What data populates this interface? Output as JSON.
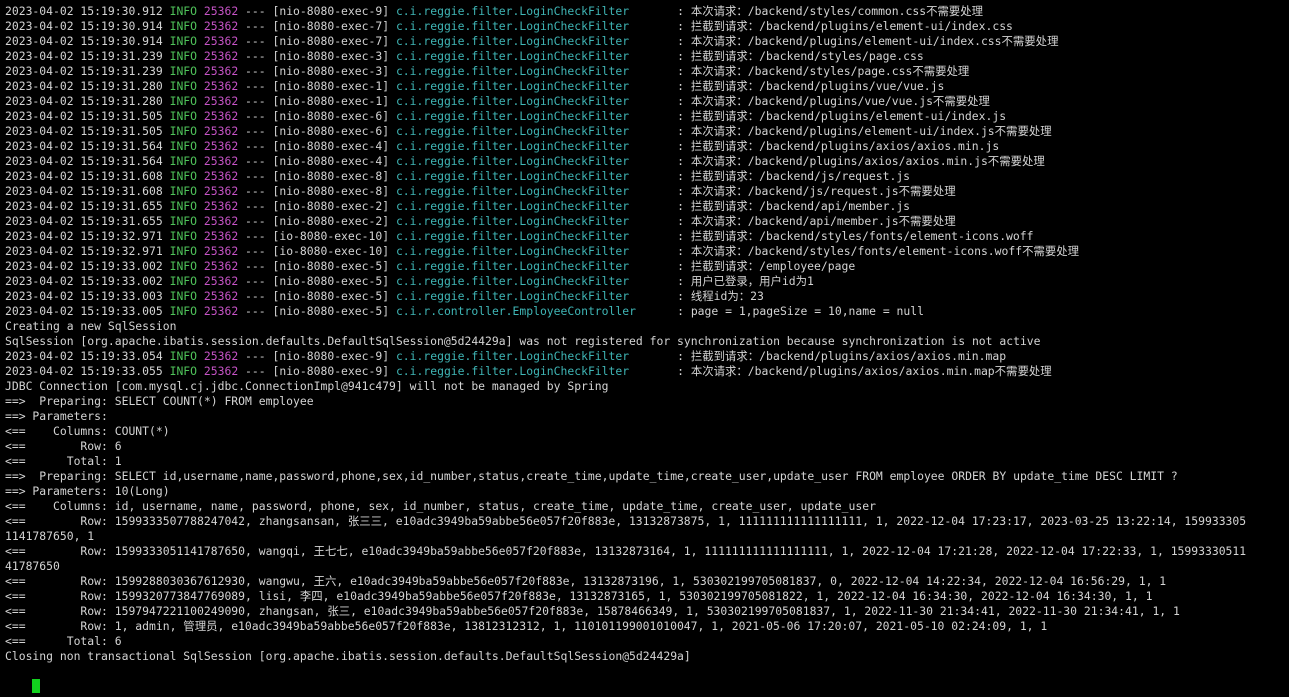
{
  "terminal": {
    "colors": {
      "background": "#000000",
      "text": "#d4d4d4",
      "level": "#4fc35a",
      "pid": "#c653c6",
      "logger": "#3fb6b6",
      "cursor": "#12d11e"
    },
    "lines": [
      {
        "type": "log",
        "ts": "2023-04-02 15:19:30.912",
        "level": "INFO",
        "pid": "25362",
        "sep": "---",
        "thread": "[nio-8080-exec-9]",
        "logger": "c.i.reggie.filter.LoginCheckFilter      ",
        "msg": ": 本次请求：/backend/styles/common.css不需要处理"
      },
      {
        "type": "log",
        "ts": "2023-04-02 15:19:30.914",
        "level": "INFO",
        "pid": "25362",
        "sep": "---",
        "thread": "[nio-8080-exec-7]",
        "logger": "c.i.reggie.filter.LoginCheckFilter      ",
        "msg": ": 拦截到请求：/backend/plugins/element-ui/index.css"
      },
      {
        "type": "log",
        "ts": "2023-04-02 15:19:30.914",
        "level": "INFO",
        "pid": "25362",
        "sep": "---",
        "thread": "[nio-8080-exec-7]",
        "logger": "c.i.reggie.filter.LoginCheckFilter      ",
        "msg": ": 本次请求：/backend/plugins/element-ui/index.css不需要处理"
      },
      {
        "type": "log",
        "ts": "2023-04-02 15:19:31.239",
        "level": "INFO",
        "pid": "25362",
        "sep": "---",
        "thread": "[nio-8080-exec-3]",
        "logger": "c.i.reggie.filter.LoginCheckFilter      ",
        "msg": ": 拦截到请求：/backend/styles/page.css"
      },
      {
        "type": "log",
        "ts": "2023-04-02 15:19:31.239",
        "level": "INFO",
        "pid": "25362",
        "sep": "---",
        "thread": "[nio-8080-exec-3]",
        "logger": "c.i.reggie.filter.LoginCheckFilter      ",
        "msg": ": 本次请求：/backend/styles/page.css不需要处理"
      },
      {
        "type": "log",
        "ts": "2023-04-02 15:19:31.280",
        "level": "INFO",
        "pid": "25362",
        "sep": "---",
        "thread": "[nio-8080-exec-1]",
        "logger": "c.i.reggie.filter.LoginCheckFilter      ",
        "msg": ": 拦截到请求：/backend/plugins/vue/vue.js"
      },
      {
        "type": "log",
        "ts": "2023-04-02 15:19:31.280",
        "level": "INFO",
        "pid": "25362",
        "sep": "---",
        "thread": "[nio-8080-exec-1]",
        "logger": "c.i.reggie.filter.LoginCheckFilter      ",
        "msg": ": 本次请求：/backend/plugins/vue/vue.js不需要处理"
      },
      {
        "type": "log",
        "ts": "2023-04-02 15:19:31.505",
        "level": "INFO",
        "pid": "25362",
        "sep": "---",
        "thread": "[nio-8080-exec-6]",
        "logger": "c.i.reggie.filter.LoginCheckFilter      ",
        "msg": ": 拦截到请求：/backend/plugins/element-ui/index.js"
      },
      {
        "type": "log",
        "ts": "2023-04-02 15:19:31.505",
        "level": "INFO",
        "pid": "25362",
        "sep": "---",
        "thread": "[nio-8080-exec-6]",
        "logger": "c.i.reggie.filter.LoginCheckFilter      ",
        "msg": ": 本次请求：/backend/plugins/element-ui/index.js不需要处理"
      },
      {
        "type": "log",
        "ts": "2023-04-02 15:19:31.564",
        "level": "INFO",
        "pid": "25362",
        "sep": "---",
        "thread": "[nio-8080-exec-4]",
        "logger": "c.i.reggie.filter.LoginCheckFilter      ",
        "msg": ": 拦截到请求：/backend/plugins/axios/axios.min.js"
      },
      {
        "type": "log",
        "ts": "2023-04-02 15:19:31.564",
        "level": "INFO",
        "pid": "25362",
        "sep": "---",
        "thread": "[nio-8080-exec-4]",
        "logger": "c.i.reggie.filter.LoginCheckFilter      ",
        "msg": ": 本次请求：/backend/plugins/axios/axios.min.js不需要处理"
      },
      {
        "type": "log",
        "ts": "2023-04-02 15:19:31.608",
        "level": "INFO",
        "pid": "25362",
        "sep": "---",
        "thread": "[nio-8080-exec-8]",
        "logger": "c.i.reggie.filter.LoginCheckFilter      ",
        "msg": ": 拦截到请求：/backend/js/request.js"
      },
      {
        "type": "log",
        "ts": "2023-04-02 15:19:31.608",
        "level": "INFO",
        "pid": "25362",
        "sep": "---",
        "thread": "[nio-8080-exec-8]",
        "logger": "c.i.reggie.filter.LoginCheckFilter      ",
        "msg": ": 本次请求：/backend/js/request.js不需要处理"
      },
      {
        "type": "log",
        "ts": "2023-04-02 15:19:31.655",
        "level": "INFO",
        "pid": "25362",
        "sep": "---",
        "thread": "[nio-8080-exec-2]",
        "logger": "c.i.reggie.filter.LoginCheckFilter      ",
        "msg": ": 拦截到请求：/backend/api/member.js"
      },
      {
        "type": "log",
        "ts": "2023-04-02 15:19:31.655",
        "level": "INFO",
        "pid": "25362",
        "sep": "---",
        "thread": "[nio-8080-exec-2]",
        "logger": "c.i.reggie.filter.LoginCheckFilter      ",
        "msg": ": 本次请求：/backend/api/member.js不需要处理"
      },
      {
        "type": "log",
        "ts": "2023-04-02 15:19:32.971",
        "level": "INFO",
        "pid": "25362",
        "sep": "---",
        "thread": "[io-8080-exec-10]",
        "logger": "c.i.reggie.filter.LoginCheckFilter      ",
        "msg": ": 拦截到请求：/backend/styles/fonts/element-icons.woff"
      },
      {
        "type": "log",
        "ts": "2023-04-02 15:19:32.971",
        "level": "INFO",
        "pid": "25362",
        "sep": "---",
        "thread": "[io-8080-exec-10]",
        "logger": "c.i.reggie.filter.LoginCheckFilter      ",
        "msg": ": 本次请求：/backend/styles/fonts/element-icons.woff不需要处理"
      },
      {
        "type": "log",
        "ts": "2023-04-02 15:19:33.002",
        "level": "INFO",
        "pid": "25362",
        "sep": "---",
        "thread": "[nio-8080-exec-5]",
        "logger": "c.i.reggie.filter.LoginCheckFilter      ",
        "msg": ": 拦截到请求：/employee/page"
      },
      {
        "type": "log",
        "ts": "2023-04-02 15:19:33.002",
        "level": "INFO",
        "pid": "25362",
        "sep": "---",
        "thread": "[nio-8080-exec-5]",
        "logger": "c.i.reggie.filter.LoginCheckFilter      ",
        "msg": ": 用户已登录，用户id为1"
      },
      {
        "type": "log",
        "ts": "2023-04-02 15:19:33.003",
        "level": "INFO",
        "pid": "25362",
        "sep": "---",
        "thread": "[nio-8080-exec-5]",
        "logger": "c.i.reggie.filter.LoginCheckFilter      ",
        "msg": ": 线程id为：23"
      },
      {
        "type": "log",
        "ts": "2023-04-02 15:19:33.005",
        "level": "INFO",
        "pid": "25362",
        "sep": "---",
        "thread": "[nio-8080-exec-5]",
        "logger": "c.i.r.controller.EmployeeController     ",
        "msg": ": page = 1,pageSize = 10,name = null"
      },
      {
        "type": "text",
        "text": "Creating a new SqlSession"
      },
      {
        "type": "text",
        "text": "SqlSession [org.apache.ibatis.session.defaults.DefaultSqlSession@5d24429a] was not registered for synchronization because synchronization is not active"
      },
      {
        "type": "log",
        "ts": "2023-04-02 15:19:33.054",
        "level": "INFO",
        "pid": "25362",
        "sep": "---",
        "thread": "[nio-8080-exec-9]",
        "logger": "c.i.reggie.filter.LoginCheckFilter      ",
        "msg": ": 拦截到请求：/backend/plugins/axios/axios.min.map"
      },
      {
        "type": "log",
        "ts": "2023-04-02 15:19:33.055",
        "level": "INFO",
        "pid": "25362",
        "sep": "---",
        "thread": "[nio-8080-exec-9]",
        "logger": "c.i.reggie.filter.LoginCheckFilter      ",
        "msg": ": 本次请求：/backend/plugins/axios/axios.min.map不需要处理"
      },
      {
        "type": "text",
        "text": "JDBC Connection [com.mysql.cj.jdbc.ConnectionImpl@941c479] will not be managed by Spring"
      },
      {
        "type": "text",
        "text": "==>  Preparing: SELECT COUNT(*) FROM employee"
      },
      {
        "type": "text",
        "text": "==> Parameters: "
      },
      {
        "type": "text",
        "text": "<==    Columns: COUNT(*)"
      },
      {
        "type": "text",
        "text": "<==        Row: 6"
      },
      {
        "type": "text",
        "text": "<==      Total: 1"
      },
      {
        "type": "text",
        "text": "==>  Preparing: SELECT id,username,name,password,phone,sex,id_number,status,create_time,update_time,create_user,update_user FROM employee ORDER BY update_time DESC LIMIT ?"
      },
      {
        "type": "text",
        "text": "==> Parameters: 10(Long)"
      },
      {
        "type": "text",
        "text": "<==    Columns: id, username, name, password, phone, sex, id_number, status, create_time, update_time, create_user, update_user"
      },
      {
        "type": "text",
        "text": "<==        Row: 1599333507788247042, zhangsansan, 张三三, e10adc3949ba59abbe56e057f20f883e, 13132873875, 1, 111111111111111111, 1, 2022-12-04 17:23:17, 2023-03-25 13:22:14, 159933305"
      },
      {
        "type": "text",
        "text": "1141787650, 1"
      },
      {
        "type": "text",
        "text": "<==        Row: 1599333051141787650, wangqi, 王七七, e10adc3949ba59abbe56e057f20f883e, 13132873164, 1, 111111111111111111, 1, 2022-12-04 17:21:28, 2022-12-04 17:22:33, 1, 15993330511"
      },
      {
        "type": "text",
        "text": "41787650"
      },
      {
        "type": "text",
        "text": "<==        Row: 1599288030367612930, wangwu, 王六, e10adc3949ba59abbe56e057f20f883e, 13132873196, 1, 530302199705081837, 0, 2022-12-04 14:22:34, 2022-12-04 16:56:29, 1, 1"
      },
      {
        "type": "text",
        "text": "<==        Row: 1599320773847769089, lisi, 李四, e10adc3949ba59abbe56e057f20f883e, 13132873165, 1, 530302199705081822, 1, 2022-12-04 16:34:30, 2022-12-04 16:34:30, 1, 1"
      },
      {
        "type": "text",
        "text": "<==        Row: 1597947221100249090, zhangsan, 张三, e10adc3949ba59abbe56e057f20f883e, 15878466349, 1, 530302199705081837, 1, 2022-11-30 21:34:41, 2022-11-30 21:34:41, 1, 1"
      },
      {
        "type": "text",
        "text": "<==        Row: 1, admin, 管理员, e10adc3949ba59abbe56e057f20f883e, 13812312312, 1, 110101199001010047, 1, 2021-05-06 17:20:07, 2021-05-10 02:24:09, 1, 1"
      },
      {
        "type": "text",
        "text": "<==      Total: 6"
      },
      {
        "type": "text",
        "text": "Closing non transactional SqlSession [org.apache.ibatis.session.defaults.DefaultSqlSession@5d24429a]"
      }
    ]
  }
}
